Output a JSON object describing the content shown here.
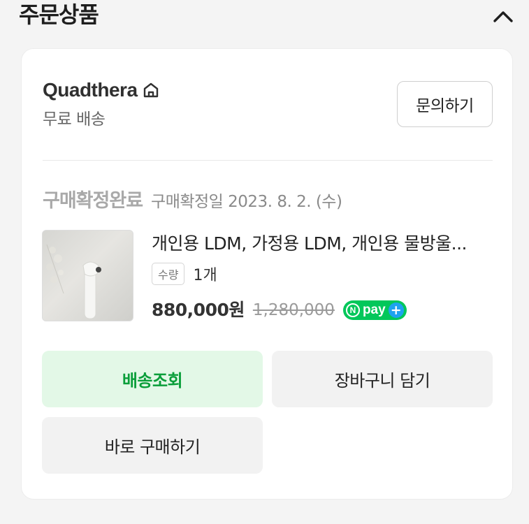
{
  "section": {
    "title": "주문상품",
    "collapse_icon": "chevron-up-icon"
  },
  "seller": {
    "name": "Quadthera",
    "home_icon": "home-icon",
    "shipping": "무료 배송",
    "inquiry_label": "문의하기"
  },
  "order": {
    "status": "구매확정완료",
    "status_date": "구매확정일 2023. 8. 2. (수)"
  },
  "product": {
    "name": "개인용 LDM, 가정용 LDM, 개인용 물방울...",
    "qty_label": "수량",
    "qty_value": "1개",
    "price": "880,000원",
    "original_price": "1,280,000",
    "npay_text": "pay",
    "npay_n": "N"
  },
  "actions": {
    "track_label": "배송조회",
    "cart_label": "장바구니 담기",
    "buy_label": "바로 구매하기"
  },
  "colors": {
    "accent_green": "#03c75a",
    "track_text": "#0a9e3a",
    "track_bg": "#e3f8e7"
  }
}
